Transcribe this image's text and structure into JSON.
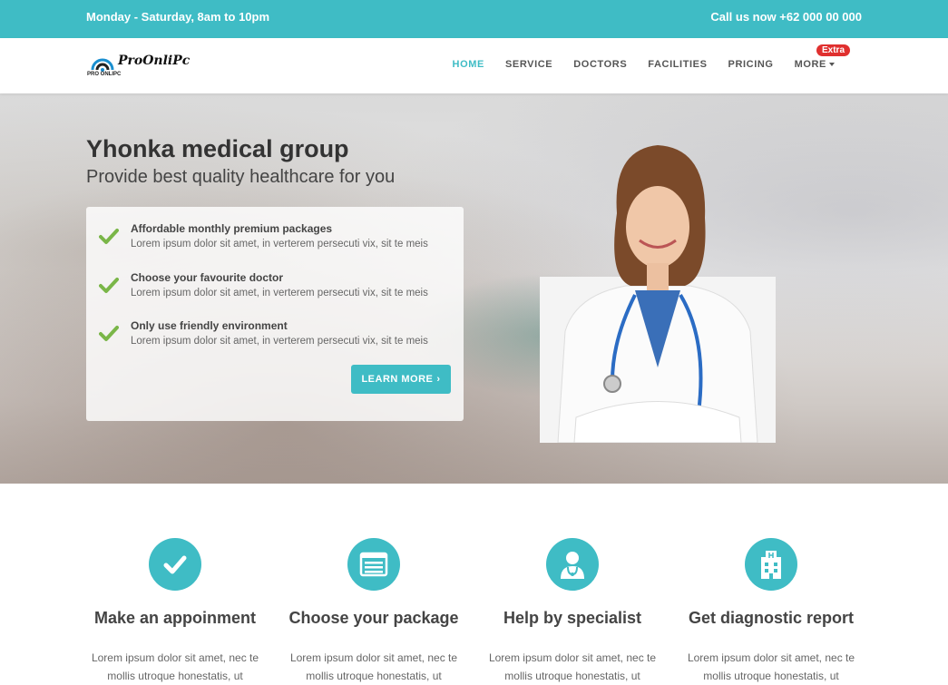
{
  "topbar": {
    "hours": "Monday - Saturday, 8am to 10pm",
    "call": "Call us now +62 000 00 000"
  },
  "logo": {
    "text": "ProOnliPc",
    "sub": "PRO ONLIPC"
  },
  "nav": {
    "items": [
      {
        "label": "HOME"
      },
      {
        "label": "SERVICE"
      },
      {
        "label": "DOCTORS"
      },
      {
        "label": "FACILITIES"
      },
      {
        "label": "PRICING"
      },
      {
        "label": "MORE"
      }
    ],
    "badge": "Extra"
  },
  "hero": {
    "title": "Yhonka medical group",
    "subtitle": "Provide best quality healthcare for you",
    "features": [
      {
        "title": "Affordable monthly premium packages",
        "desc": "Lorem ipsum dolor sit amet, in verterem persecuti vix, sit te meis"
      },
      {
        "title": "Choose your favourite doctor",
        "desc": "Lorem ipsum dolor sit amet, in verterem persecuti vix, sit te meis"
      },
      {
        "title": "Only use friendly environment",
        "desc": "Lorem ipsum dolor sit amet, in verterem persecuti vix, sit te meis"
      }
    ],
    "button": "LEARN MORE"
  },
  "services": [
    {
      "icon": "check-icon",
      "title": "Make an appoinment",
      "text1": "Lorem ipsum dolor sit amet, nec te",
      "text2": "mollis utroque honestatis, ut"
    },
    {
      "icon": "list-icon",
      "title": "Choose your package",
      "text1": "Lorem ipsum dolor sit amet, nec te",
      "text2": "mollis utroque honestatis, ut"
    },
    {
      "icon": "doctor-icon",
      "title": "Help by specialist",
      "text1": "Lorem ipsum dolor sit amet, nec te",
      "text2": "mollis utroque honestatis, ut"
    },
    {
      "icon": "hospital-icon",
      "title": "Get diagnostic report",
      "text1": "Lorem ipsum dolor sit amet, nec te",
      "text2": "mollis utroque honestatis, ut"
    }
  ],
  "colors": {
    "accent": "#3fbcc5",
    "check": "#7ab648",
    "badge": "#e0302f"
  }
}
